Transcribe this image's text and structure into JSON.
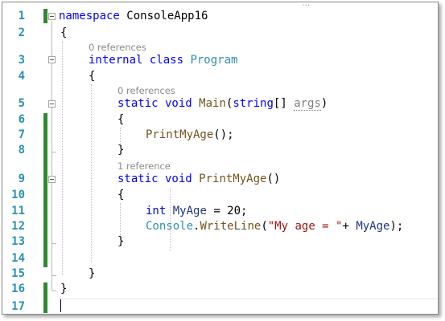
{
  "editor": {
    "top_hint": "...",
    "lines": [
      "1",
      "2",
      "3",
      "4",
      "5",
      "6",
      "7",
      "8",
      "9",
      "10",
      "11",
      "12",
      "13",
      "14",
      "15",
      "16",
      "17"
    ],
    "code": {
      "ns_kw": "namespace",
      "ns_name": " ConsoleApp16",
      "brace_open": "{",
      "brace_close": "}",
      "class_lens": "0 references",
      "class_kw": "internal class",
      "class_name": "Program",
      "main_lens": "0 references",
      "main_kw": "static void",
      "main_name": "Main",
      "main_paren_open": "(",
      "main_param_type": "string",
      "main_brackets": "[] ",
      "main_param": "args",
      "main_paren_close": ")",
      "call_name": "PrintMyAge",
      "call_tail": "();",
      "method_lens": "1 reference",
      "method_kw": "static void",
      "method_name": "PrintMyAge",
      "method_parens": "()",
      "decl_kw": "int",
      "decl_var": "MyAge",
      "decl_tail": " = 20;",
      "console_type": "Console",
      "dot": ".",
      "writeline": "WriteLine",
      "wl_open": "(",
      "wl_string": "\"My age = \"",
      "wl_plus": "+ ",
      "wl_var": "MyAge",
      "wl_close": ");"
    }
  },
  "colors": {
    "keyword": "#0000ff",
    "type": "#2b91af",
    "method": "#74531f",
    "variable": "#1f377f",
    "string": "#a31515",
    "line_number": "#2b91af",
    "change_bar": "#2f8a2f"
  }
}
